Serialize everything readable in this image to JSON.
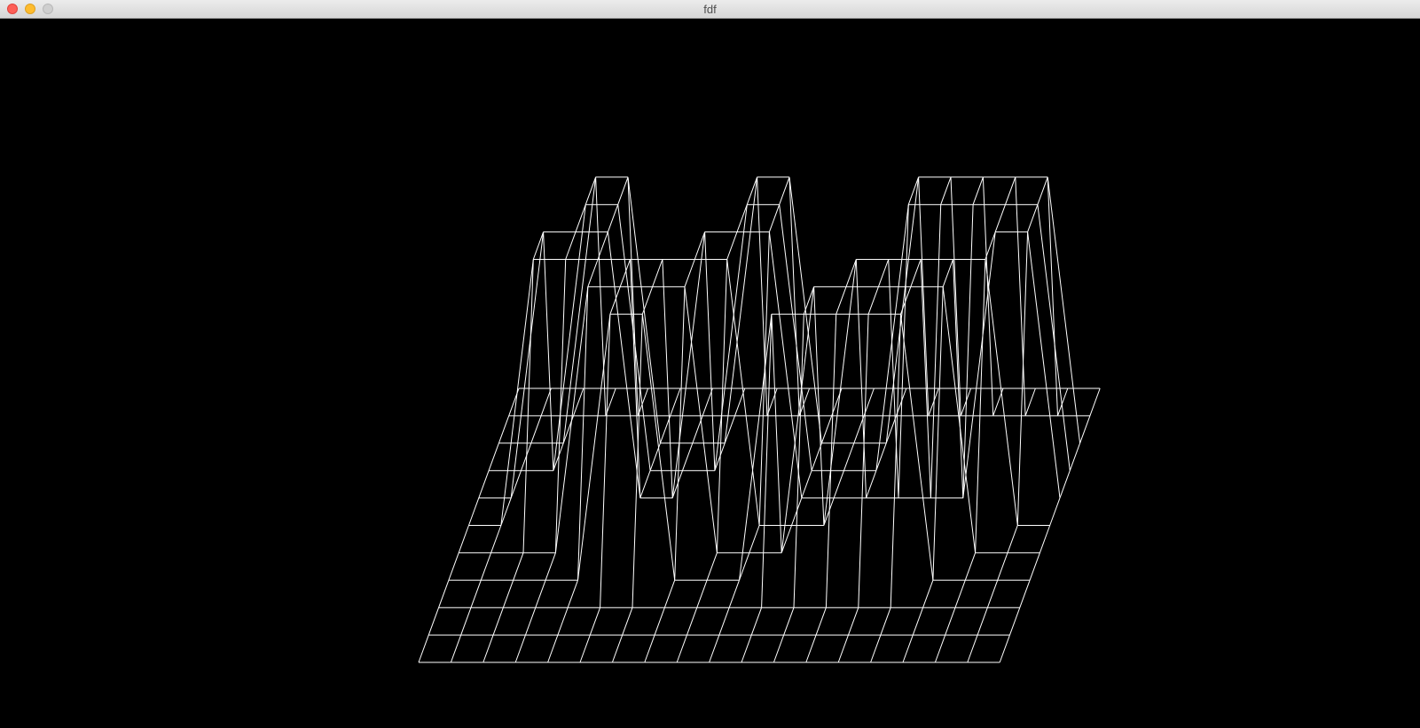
{
  "window": {
    "title": "fdf"
  },
  "buttons": {
    "close_icon": "close-circle-icon",
    "minimize_icon": "minimize-circle-icon",
    "zoom_icon": "zoom-circle-icon"
  },
  "colors": {
    "background": "#000000",
    "wire": "#ffffff"
  },
  "map": {
    "cols": 19,
    "rows": 11,
    "heights": [
      [
        0,
        0,
        0,
        0,
        0,
        0,
        0,
        0,
        0,
        0,
        0,
        0,
        0,
        0,
        0,
        0,
        0,
        0,
        0
      ],
      [
        0,
        0,
        0,
        0,
        0,
        0,
        0,
        0,
        0,
        0,
        0,
        0,
        0,
        0,
        0,
        0,
        0,
        0,
        0
      ],
      [
        0,
        0,
        0,
        10,
        10,
        0,
        0,
        0,
        10,
        10,
        0,
        0,
        0,
        10,
        10,
        10,
        10,
        10,
        0
      ],
      [
        0,
        0,
        0,
        10,
        10,
        0,
        0,
        0,
        10,
        10,
        0,
        0,
        0,
        10,
        10,
        10,
        10,
        10,
        0
      ],
      [
        0,
        0,
        10,
        10,
        10,
        0,
        0,
        10,
        10,
        10,
        0,
        0,
        0,
        0,
        0,
        0,
        10,
        10,
        0
      ],
      [
        0,
        0,
        10,
        10,
        10,
        10,
        10,
        10,
        10,
        0,
        0,
        0,
        10,
        10,
        10,
        10,
        10,
        0,
        0
      ],
      [
        0,
        0,
        0,
        0,
        10,
        10,
        10,
        10,
        0,
        0,
        0,
        10,
        10,
        10,
        10,
        10,
        0,
        0,
        0
      ],
      [
        0,
        0,
        0,
        0,
        0,
        10,
        10,
        0,
        0,
        0,
        10,
        10,
        10,
        10,
        10,
        0,
        0,
        0,
        0
      ],
      [
        0,
        0,
        0,
        0,
        0,
        0,
        0,
        0,
        0,
        0,
        0,
        0,
        0,
        0,
        0,
        0,
        0,
        0,
        0
      ],
      [
        0,
        0,
        0,
        0,
        0,
        0,
        0,
        0,
        0,
        0,
        0,
        0,
        0,
        0,
        0,
        0,
        0,
        0,
        0
      ],
      [
        0,
        0,
        0,
        0,
        0,
        0,
        0,
        0,
        0,
        0,
        0,
        0,
        0,
        0,
        0,
        0,
        0,
        0,
        0
      ]
    ]
  }
}
